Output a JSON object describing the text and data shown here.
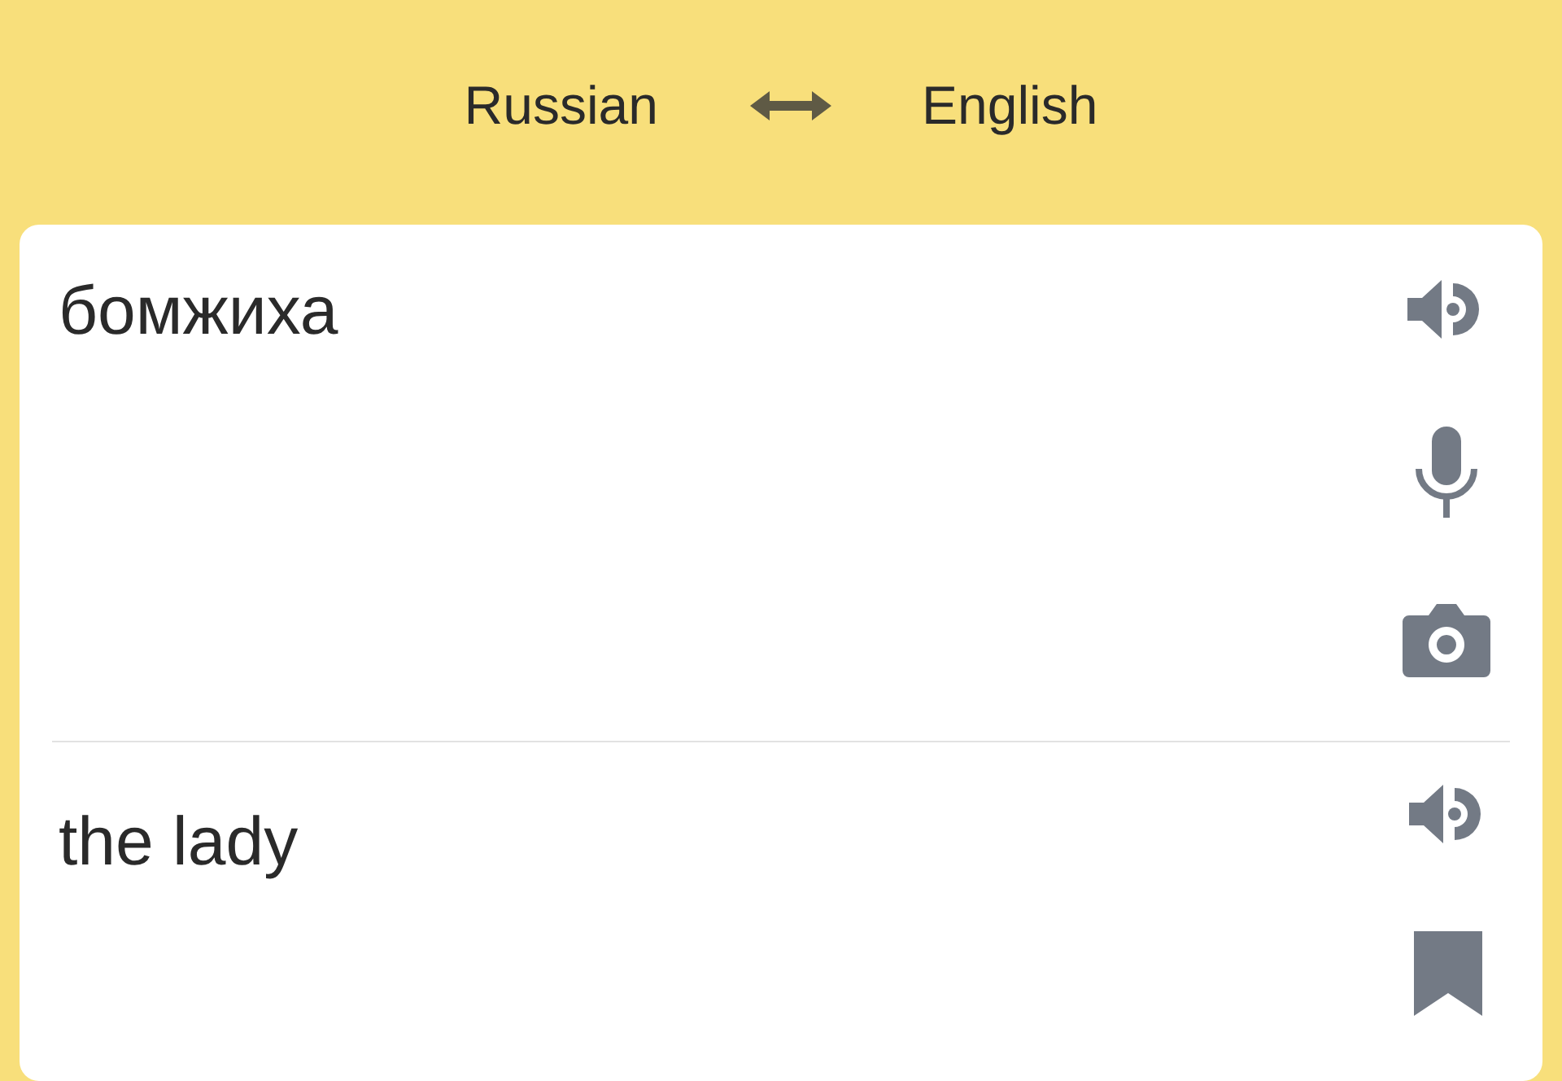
{
  "languages": {
    "source": "Russian",
    "target": "English"
  },
  "input": {
    "value": "бомжиха"
  },
  "output": {
    "text": "the lady"
  }
}
